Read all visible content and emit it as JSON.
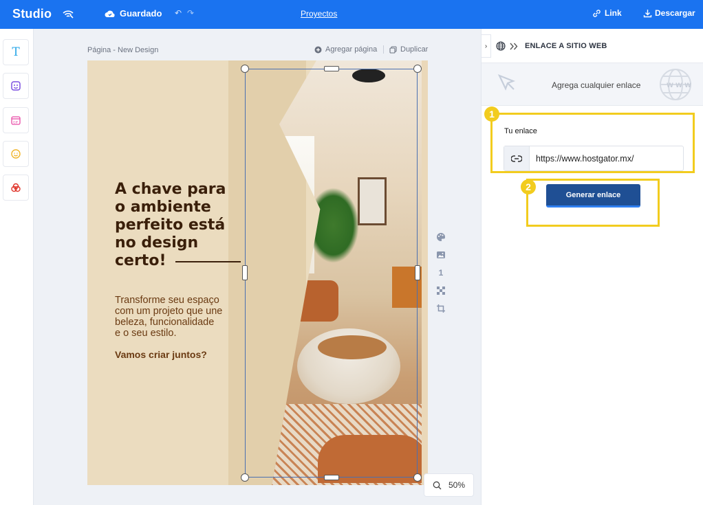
{
  "topbar": {
    "logo": "Studio",
    "saved_label": "Guardado",
    "projects_label": "Proyectos",
    "link_label": "Link",
    "download_label": "Descargar",
    "bg_color": "#1a73f0"
  },
  "leftbar": {
    "tools": [
      {
        "name": "text-tool",
        "icon": "T"
      },
      {
        "name": "image-tool",
        "icon": "image-smile-icon"
      },
      {
        "name": "gif-tool",
        "icon": "gif-icon"
      },
      {
        "name": "emoji-tool",
        "icon": "smile-icon"
      },
      {
        "name": "shapes-tool",
        "icon": "shapes-icon"
      }
    ]
  },
  "canvas": {
    "page_label": "Página - New Design",
    "add_page_label": "Agregar página",
    "duplicate_label": "Duplicar",
    "page_number": "1",
    "zoom": "50%"
  },
  "design": {
    "headline": [
      "A chave para",
      "o ambiente",
      "perfeito está",
      "no design",
      "certo!"
    ],
    "body": [
      "Transforme seu espaço",
      "com um projeto que une",
      "beleza, funcionalidade",
      "e o seu estilo."
    ],
    "cta": "Vamos criar juntos?"
  },
  "panel": {
    "title": "ENLACE A SITIO WEB",
    "hint": "Agrega cualquier enlace",
    "field_label": "Tu enlace",
    "url_value": "https://www.hostgator.mx/",
    "generate_label": "Generar enlace",
    "badge1": "1",
    "badge2": "2",
    "highlight_color": "#f2cc1e"
  }
}
